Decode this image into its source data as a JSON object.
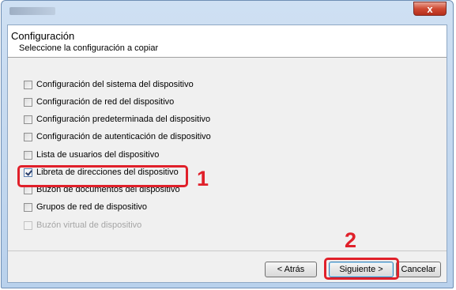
{
  "dialog": {
    "close_glyph": "x",
    "header": {
      "title": "Configuración",
      "subtitle": "Seleccione la configuración a copiar"
    },
    "options": [
      {
        "label": "Configuración del sistema del dispositivo",
        "checked": false,
        "enabled": true
      },
      {
        "label": "Configuración de red del dispositivo",
        "checked": false,
        "enabled": true
      },
      {
        "label": "Configuración predeterminada del dispositivo",
        "checked": false,
        "enabled": true
      },
      {
        "label": "Configuración de autenticación de dispositivo",
        "checked": false,
        "enabled": true
      },
      {
        "label": "Lista de usuarios del dispositivo",
        "checked": false,
        "enabled": true
      },
      {
        "label": "Libreta de direcciones del dispositivo",
        "checked": true,
        "enabled": true
      },
      {
        "label": "Buzón de documentos del dispositivo",
        "checked": false,
        "enabled": true
      },
      {
        "label": "Grupos de red de dispositivo",
        "checked": false,
        "enabled": true
      },
      {
        "label": "Buzón virtual de dispositivo",
        "checked": false,
        "enabled": false
      }
    ],
    "buttons": {
      "back": "< Atrás",
      "next": "Siguiente >",
      "cancel": "Cancelar"
    }
  },
  "annotations": {
    "callout_1": "1",
    "callout_2": "2",
    "highlight_color": "#e0202a"
  }
}
